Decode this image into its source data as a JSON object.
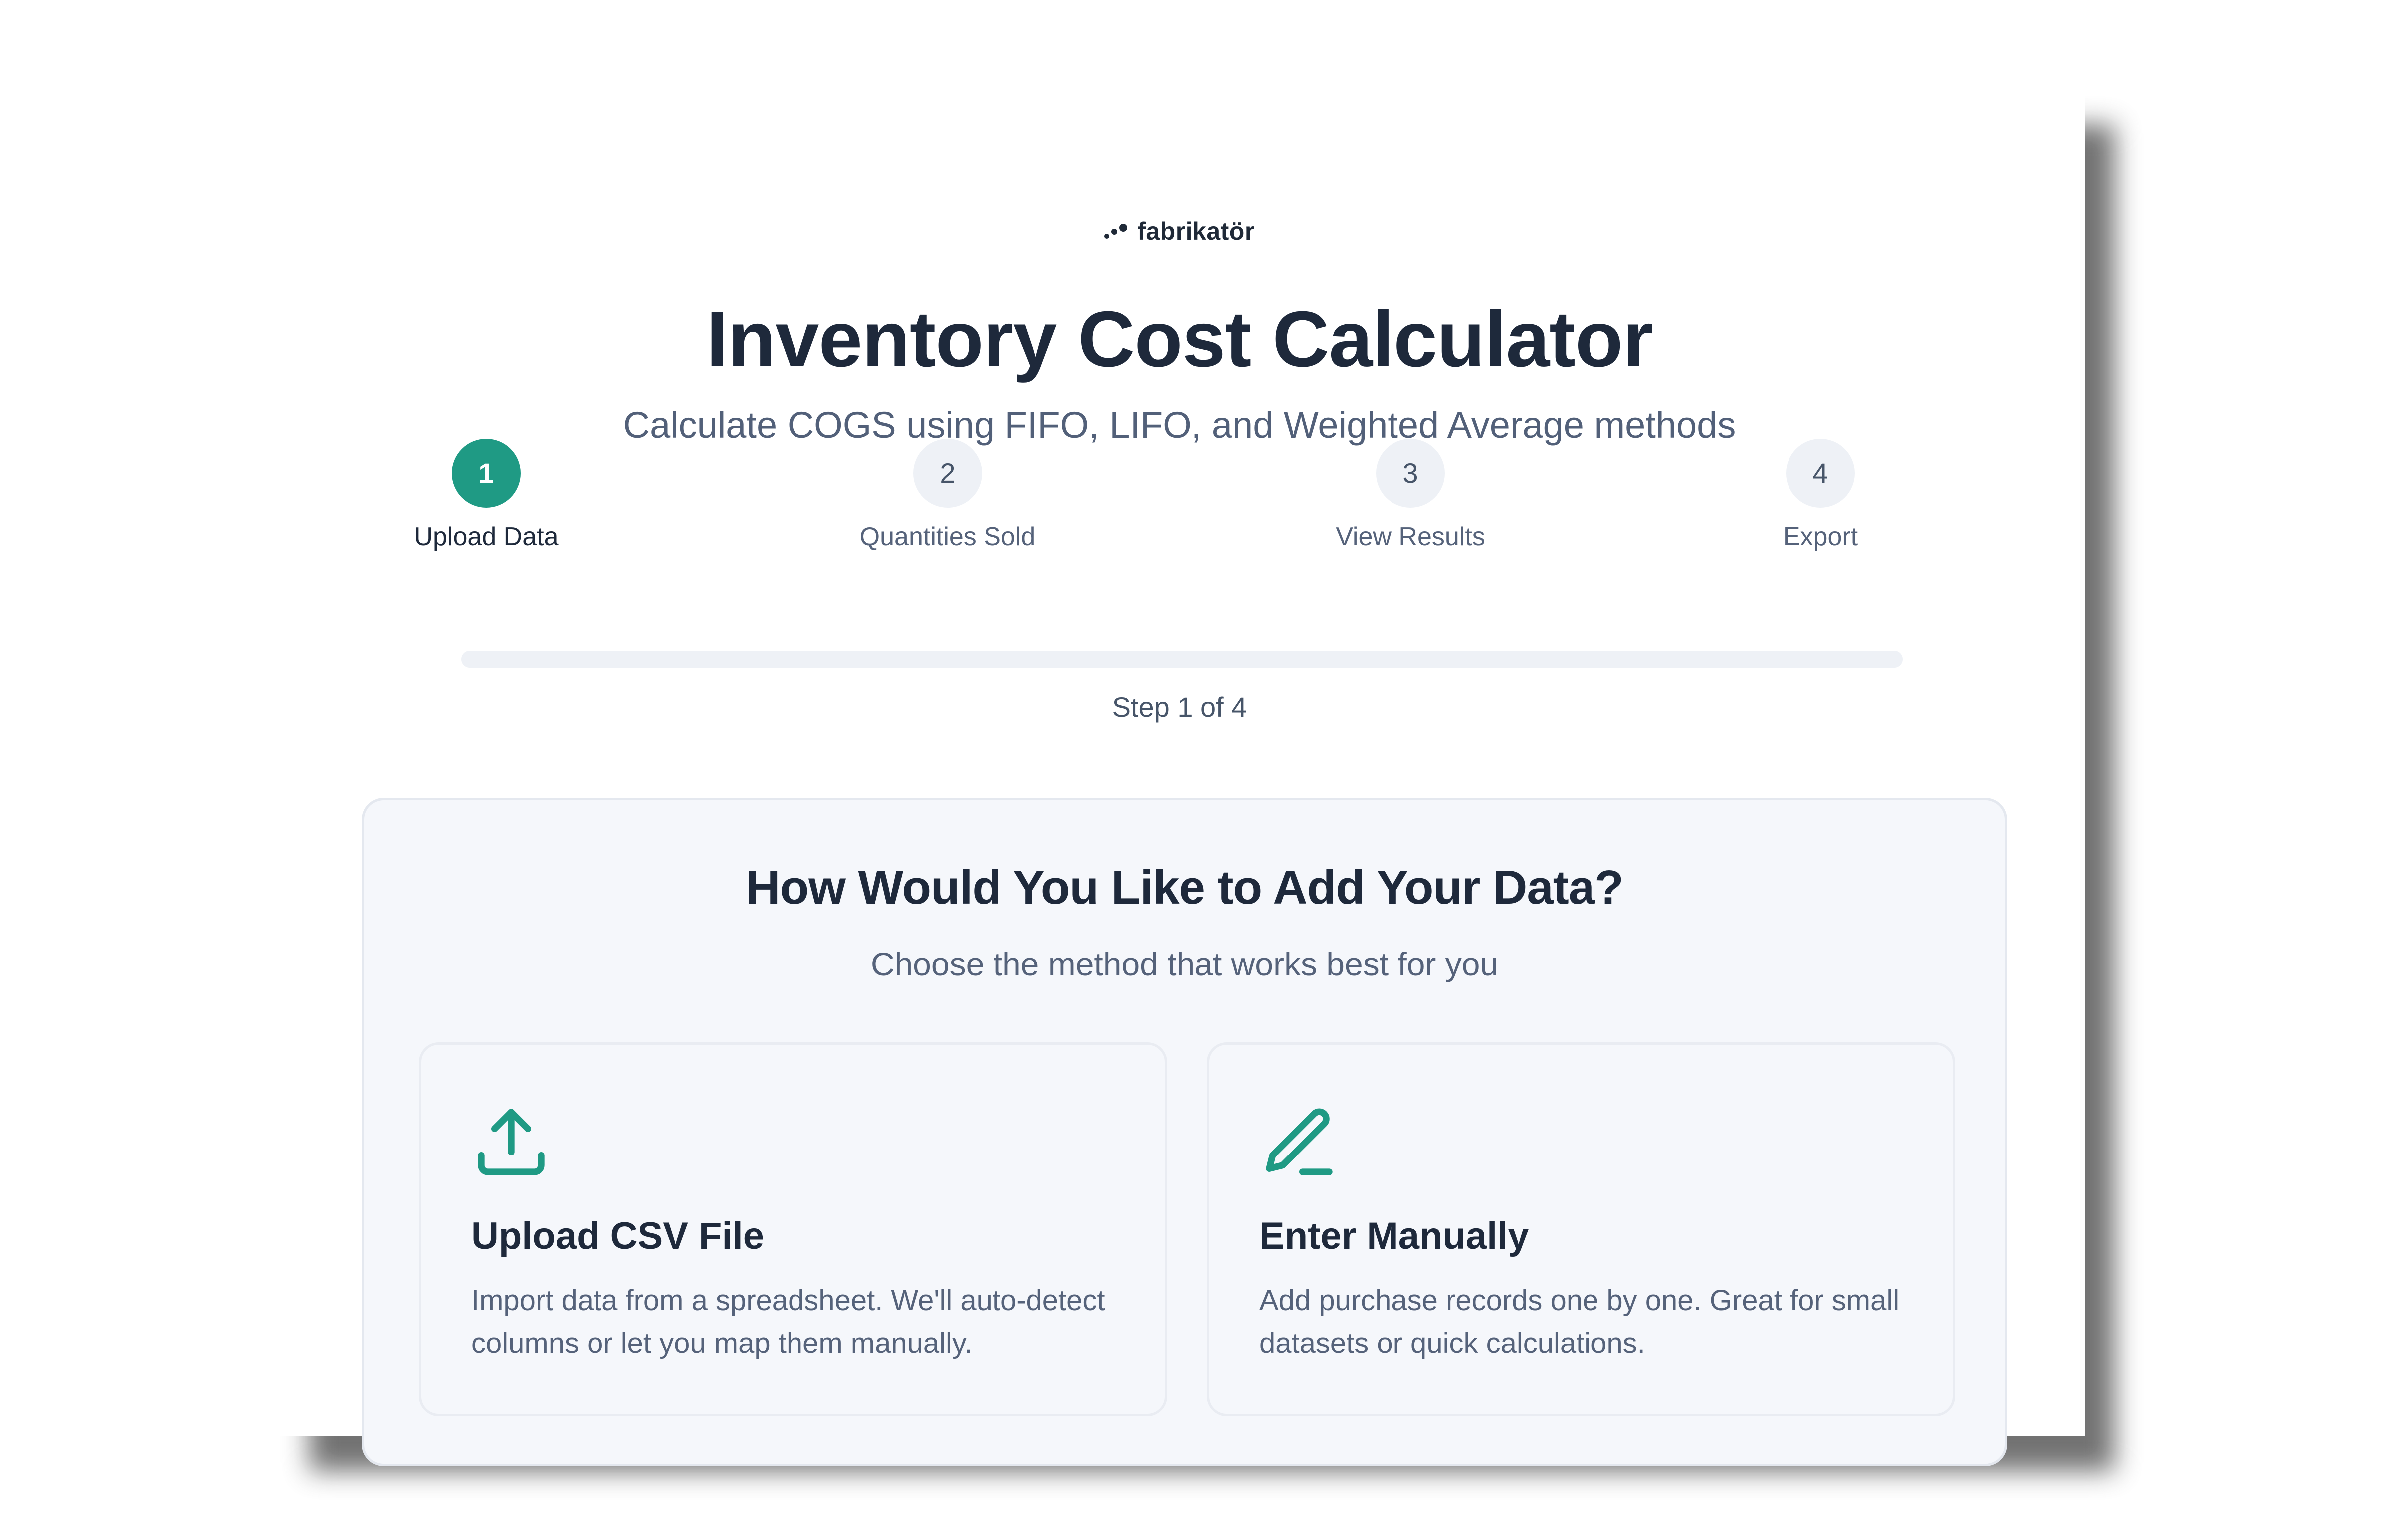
{
  "brand": {
    "name": "fabrikatör"
  },
  "header": {
    "title": "Inventory Cost Calculator",
    "subtitle": "Calculate COGS using FIFO, LIFO, and Weighted Average methods"
  },
  "stepper": {
    "steps": [
      {
        "number": "1",
        "label": "Upload Data",
        "state": "active"
      },
      {
        "number": "2",
        "label": "Quantities Sold",
        "state": "pending"
      },
      {
        "number": "3",
        "label": "View Results",
        "state": "pending"
      },
      {
        "number": "4",
        "label": "Export",
        "state": "pending"
      }
    ],
    "progress_fraction": 0,
    "step_count_text": "Step 1 of 4"
  },
  "panel": {
    "title": "How Would You Like to Add Your Data?",
    "subtitle": "Choose the method that works best for you",
    "options": [
      {
        "icon": "upload-icon",
        "title": "Upload CSV File",
        "description": "Import data from a spreadsheet. We'll auto-detect columns or let you map them manually."
      },
      {
        "icon": "pencil-icon",
        "title": "Enter Manually",
        "description": "Add purchase records one by one. Great for small datasets or quick calculations."
      }
    ]
  },
  "colors": {
    "accent": "#1f9a84",
    "heading": "#1e293b",
    "muted": "#55627a",
    "panel_bg": "#f5f7fb"
  }
}
